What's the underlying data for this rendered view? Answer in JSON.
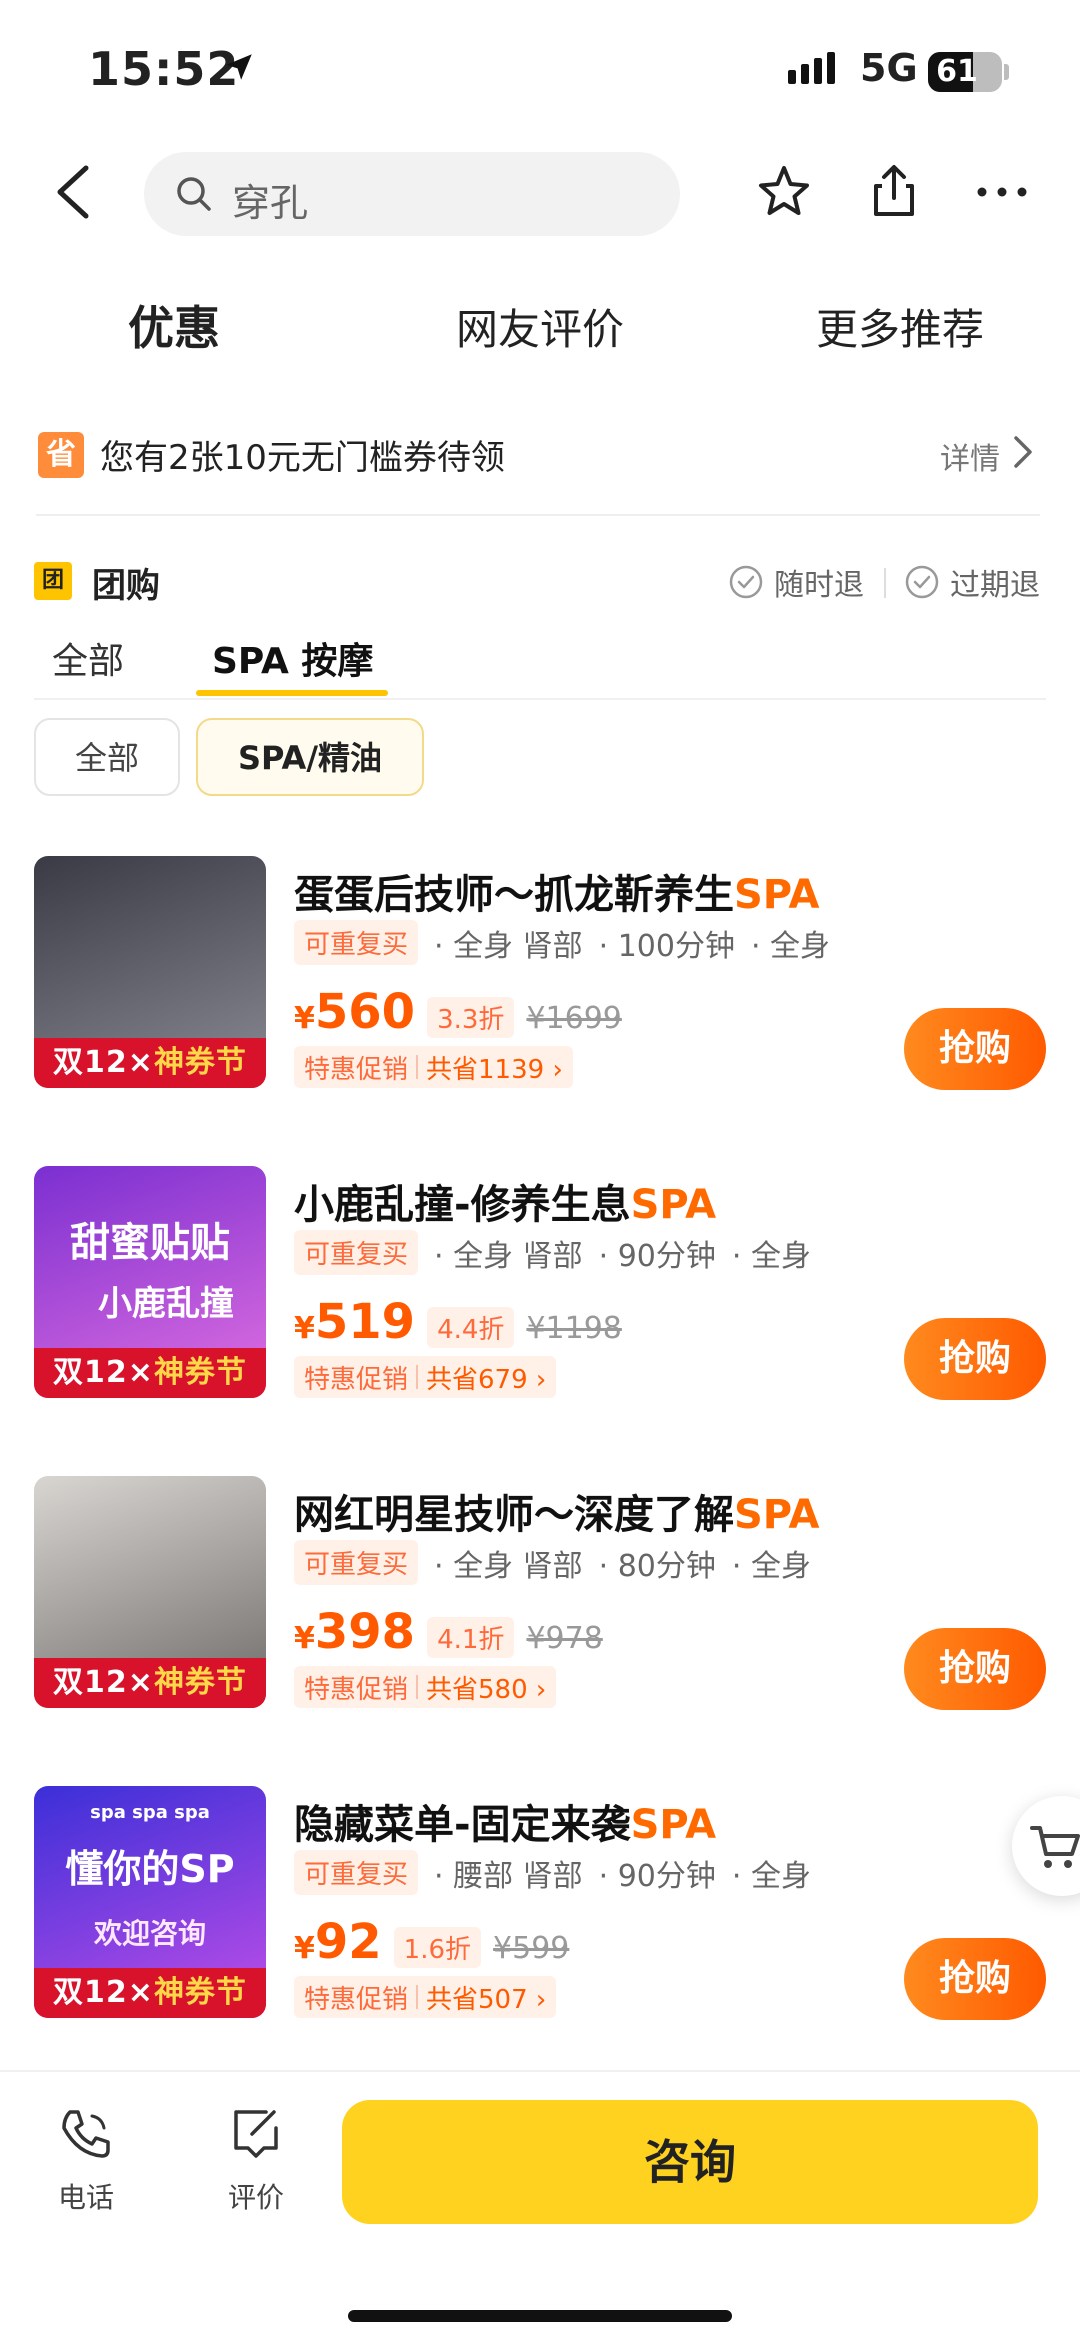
{
  "status": {
    "time": "15:52",
    "network": "5G",
    "battery": "61",
    "battery_level": 0.61
  },
  "search": {
    "value": "穿孔"
  },
  "tabs": [
    {
      "label": "优惠",
      "active": true
    },
    {
      "label": "网友评价",
      "active": false
    },
    {
      "label": "更多推荐",
      "active": false
    }
  ],
  "coupon": {
    "badge": "省",
    "text": "您有2张10元无门槛券待领",
    "detail": "详情"
  },
  "group": {
    "badge": "团",
    "title": "团购",
    "guarantees": [
      "随时退",
      "过期退"
    ],
    "sub_tabs": [
      "全部",
      "SPA 按摩"
    ],
    "chips": [
      "全部",
      "SPA/精油"
    ]
  },
  "deals": [
    {
      "title": "蛋蛋后技师～抓龙靳养生",
      "spa": "SPA",
      "rebuy": "可重复买",
      "attrs": [
        "· 全身 肾部",
        "· 100分钟",
        "· 全身"
      ],
      "yen": "¥",
      "price": "560",
      "discount": "3.3折",
      "original": "¥1699",
      "promo_label": "特惠促销",
      "save": "共省1139 ›",
      "buy": "抢购",
      "thumb_banner": [
        "双12×",
        "神券节"
      ],
      "thumb_colors": [
        "#3a3a44",
        "#8b8b95"
      ]
    },
    {
      "title": "小鹿乱撞-修养生息",
      "spa": "SPA",
      "rebuy": "可重复买",
      "attrs": [
        "· 全身 肾部",
        "· 90分钟",
        "· 全身"
      ],
      "yen": "¥",
      "price": "519",
      "discount": "4.4折",
      "original": "¥1198",
      "promo_label": "特惠促销",
      "save": "共省679 ›",
      "buy": "抢购",
      "thumb_banner": [
        "双12×",
        "神券节"
      ],
      "thumb_text": [
        "甜蜜贴贴",
        "小鹿乱撞"
      ],
      "thumb_colors": [
        "#7b2fd1",
        "#e06fe0"
      ]
    },
    {
      "title": "网红明星技师～深度了解",
      "spa": "SPA",
      "rebuy": "可重复买",
      "attrs": [
        "· 全身 肾部",
        "· 80分钟",
        "· 全身"
      ],
      "yen": "¥",
      "price": "398",
      "discount": "4.1折",
      "original": "¥978",
      "promo_label": "特惠促销",
      "save": "共省580 ›",
      "buy": "抢购",
      "thumb_banner": [
        "双12×",
        "神券节"
      ],
      "thumb_colors": [
        "#d9d6d2",
        "#6d6a68"
      ]
    },
    {
      "title": "隐藏菜单-固定来袭",
      "spa": "SPA",
      "rebuy": "可重复买",
      "attrs": [
        "· 腰部 肾部",
        "· 90分钟",
        "· 全身"
      ],
      "yen": "¥",
      "price": "92",
      "discount": "1.6折",
      "original": "¥599",
      "promo_label": "特惠促销",
      "save": "共省507 ›",
      "buy": "抢购",
      "thumb_banner": [
        "双12×",
        "神券节"
      ],
      "thumb_text": [
        "spa spa spa",
        "懂你的SP",
        "欢迎咨询"
      ],
      "thumb_colors": [
        "#3b2fd8",
        "#c04fe8"
      ]
    }
  ],
  "bottom": {
    "phone": "电话",
    "review": "评价",
    "consult": "咨询"
  },
  "colors": {
    "accent": "#ffd21f",
    "price": "#ff5a00",
    "buy_btn": "#ff6a00"
  }
}
